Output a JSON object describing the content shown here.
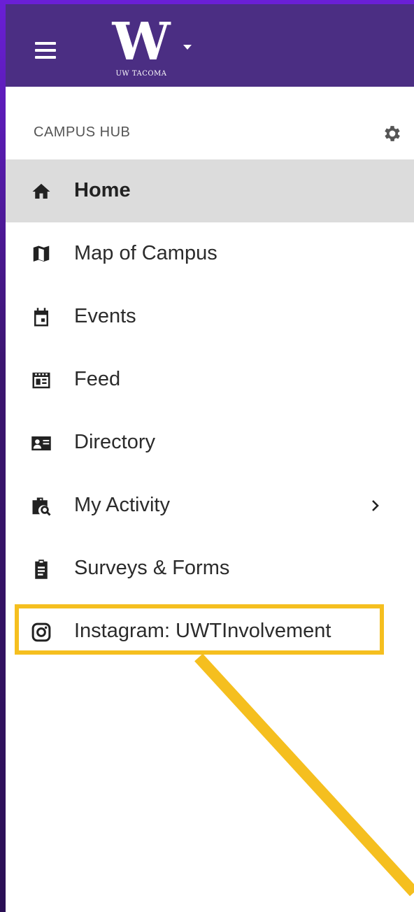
{
  "header": {
    "logo_letter": "W",
    "logo_subtitle": "UW TACOMA",
    "brand_color": "#4b2e83"
  },
  "section": {
    "title": "CAMPUS HUB"
  },
  "nav": {
    "items": [
      {
        "label": "Home",
        "icon": "home-icon",
        "active": true
      },
      {
        "label": "Map of Campus",
        "icon": "map-icon"
      },
      {
        "label": "Events",
        "icon": "calendar-icon"
      },
      {
        "label": "Feed",
        "icon": "feed-icon"
      },
      {
        "label": "Directory",
        "icon": "contact-card-icon"
      },
      {
        "label": "My Activity",
        "icon": "activity-search-icon",
        "has_submenu": true
      },
      {
        "label": "Surveys & Forms",
        "icon": "clipboard-icon"
      },
      {
        "label": "Instagram: UWTInvolvement",
        "icon": "instagram-icon",
        "highlighted": true
      }
    ]
  },
  "annotation": {
    "highlight_color": "#f5bf1f"
  }
}
